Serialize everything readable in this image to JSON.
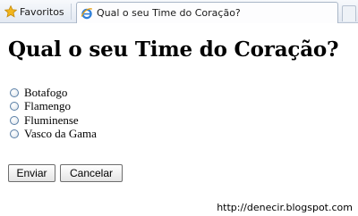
{
  "browser": {
    "favorites_label": "Favoritos",
    "tab_title": "Qual o seu Time do Coração?"
  },
  "page": {
    "heading": "Qual o seu Time do Coração?",
    "options": [
      "Botafogo",
      "Flamengo",
      "Fluminense",
      "Vasco da Gama"
    ],
    "submit_label": "Enviar",
    "cancel_label": "Cancelar"
  },
  "footer": {
    "url_text": "http://denecir.blogspot.com"
  },
  "icons": {
    "favorites": "star-icon",
    "tab": "ie-icon"
  },
  "colors": {
    "star": "#f2b51c",
    "ie_blue": "#2f7fd8",
    "radio_border": "#5a7fa6"
  }
}
